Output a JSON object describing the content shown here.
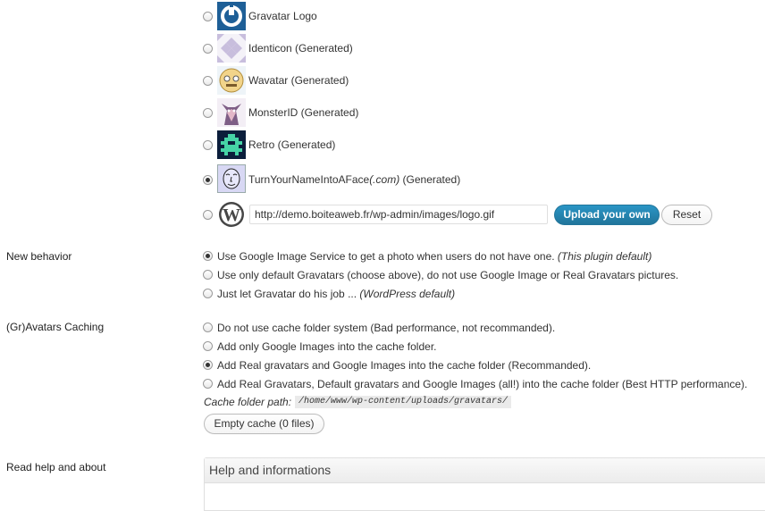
{
  "default_avatars": [
    {
      "name": "Gravatar Logo",
      "checked": false,
      "icon": "gravatar-logo-icon"
    },
    {
      "name": "Identicon (Generated)",
      "checked": false,
      "icon": "identicon-icon"
    },
    {
      "name": "Wavatar (Generated)",
      "checked": false,
      "icon": "wavatar-icon"
    },
    {
      "name": "MonsterID (Generated)",
      "checked": false,
      "icon": "monsterid-icon"
    },
    {
      "name": "Retro (Generated)",
      "checked": false,
      "icon": "retro-icon"
    },
    {
      "name": "TurnYourNameIntoAFace",
      "name_suffix_italic": "(.com)",
      "name_suffix": "(Generated)",
      "checked": true,
      "icon": "face-icon"
    },
    {
      "checked": false,
      "icon": "wordpress-logo-icon",
      "url_value": "http://demo.boiteaweb.fr/wp-admin/images/logo.gif",
      "upload_label": "Upload your own",
      "reset_label": "Reset"
    }
  ],
  "new_behavior": {
    "label": "New behavior",
    "options": [
      {
        "text": "Use Google Image Service to get a photo when users do not have one.",
        "note": "(This plugin default)",
        "checked": true
      },
      {
        "text": "Use only default Gravatars (choose above), do not use Google Image or Real Gravatars pictures.",
        "note": "",
        "checked": false
      },
      {
        "text": "Just let Gravatar do his job ...",
        "note": "(WordPress default)",
        "checked": false
      }
    ]
  },
  "caching": {
    "label": "(Gr)Avatars Caching",
    "options": [
      {
        "text": "Do not use cache folder system (Bad performance, not recommanded).",
        "checked": false
      },
      {
        "text": "Add only Google Images into the cache folder.",
        "checked": false
      },
      {
        "text": "Add Real gravatars and Google Images into the cache folder (Recommanded).",
        "checked": true
      },
      {
        "text": "Add Real Gravatars, Default gravatars and Google Images (all!) into the cache folder (Best HTTP performance).",
        "checked": false
      }
    ],
    "path_label": "Cache folder path:",
    "path_value": "/home/www/wp-content/uploads/gravatars/",
    "empty_label": "Empty cache (0 files)"
  },
  "help": {
    "label": "Read help and about",
    "panel_title": "Help and informations"
  },
  "colors": {
    "primary_button": "#21759b",
    "icon_blue": "#1e5f97"
  }
}
